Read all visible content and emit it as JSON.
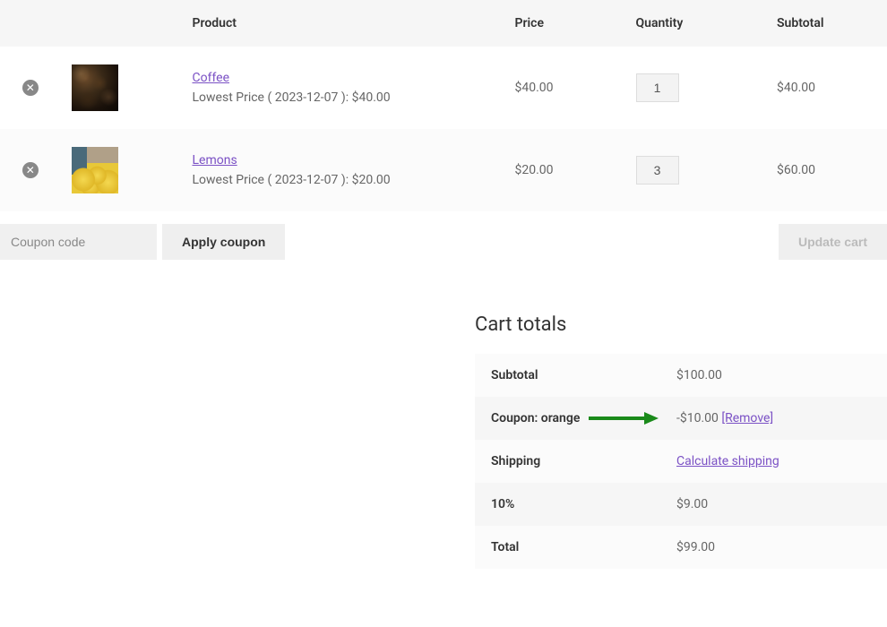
{
  "table": {
    "headers": {
      "product": "Product",
      "price": "Price",
      "quantity": "Quantity",
      "subtotal": "Subtotal"
    },
    "rows": [
      {
        "name": "Coffee",
        "lowest_price": "Lowest Price ( 2023-12-07 ): $40.00",
        "price": "$40.00",
        "qty": "1",
        "subtotal": "$40.00",
        "thumb": "thumb-coffee"
      },
      {
        "name": "Lemons",
        "lowest_price": "Lowest Price ( 2023-12-07 ): $20.00",
        "price": "$20.00",
        "qty": "3",
        "subtotal": "$60.00",
        "thumb": "thumb-lemons"
      }
    ]
  },
  "coupon": {
    "placeholder": "Coupon code",
    "apply_label": "Apply coupon",
    "update_label": "Update cart"
  },
  "totals": {
    "title": "Cart totals",
    "subtotal_label": "Subtotal",
    "subtotal_value": "$100.00",
    "coupon_label": "Coupon: orange",
    "coupon_value": "-$10.00",
    "coupon_remove": "[Remove]",
    "shipping_label": "Shipping",
    "shipping_link": "Calculate shipping",
    "tax_label": "10%",
    "tax_value": "$9.00",
    "total_label": "Total",
    "total_value": "$99.00"
  },
  "colors": {
    "arrow": "#1a8a1a"
  }
}
